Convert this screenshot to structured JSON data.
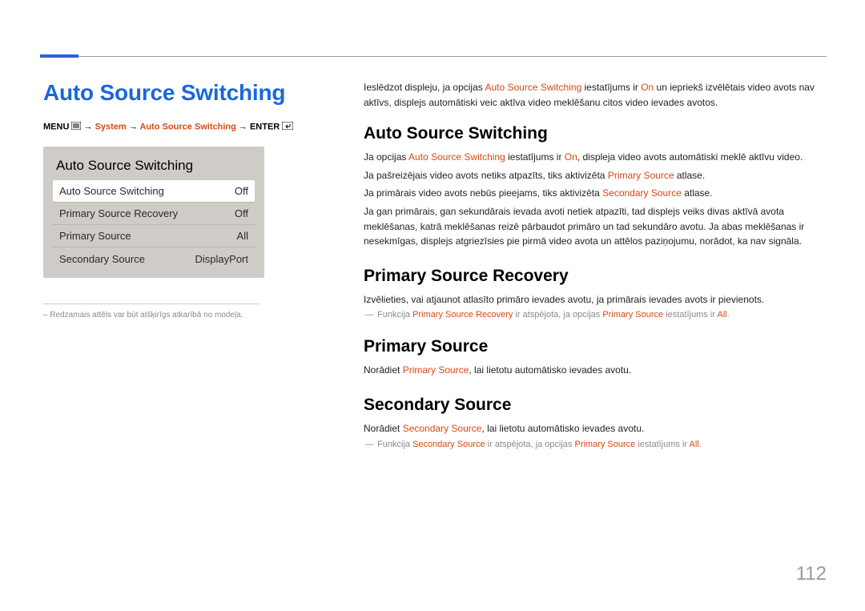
{
  "page_title": "Auto Source Switching",
  "breadcrumb": {
    "menu": "MENU",
    "arrow": "→",
    "system": "System",
    "auto": "Auto Source Switching",
    "enter": "ENTER"
  },
  "lcd": {
    "title": "Auto Source Switching",
    "rows": [
      {
        "label": "Auto Source Switching",
        "value": "Off",
        "selected": true
      },
      {
        "label": "Primary Source Recovery",
        "value": "Off",
        "selected": false
      },
      {
        "label": "Primary Source",
        "value": "All",
        "selected": false
      },
      {
        "label": "Secondary Source",
        "value": "DisplayPort",
        "selected": false
      }
    ]
  },
  "left_footnote": "– Redzamais attēls var būt atšķirīgs atkarībā no modeļa.",
  "intro": {
    "p1a": "Ieslēdzot displeju, ja opcijas ",
    "p1b": "Auto Source Switching",
    "p1c": " iestatījums ir ",
    "p1d": "On",
    "p1e": " un iepriekš izvēlētais video avots nav aktīvs, displejs automātiski veic aktīva video meklēšanu citos video ievades avotos."
  },
  "sections": {
    "auto": {
      "heading": "Auto Source Switching",
      "p1a": "Ja opcijas ",
      "p1b": "Auto Source Switching",
      "p1c": " iestatījums ir ",
      "p1d": "On",
      "p1e": ", displeja video avots automātiski meklē aktīvu video.",
      "p2a": "Ja pašreizējais video avots netiks atpazīts, tiks aktivizēta ",
      "p2b": "Primary Source",
      "p2c": " atlase.",
      "p3a": "Ja primārais video avots nebūs pieejams, tiks aktivizēta ",
      "p3b": "Secondary Source",
      "p3c": " atlase.",
      "p4": "Ja gan primārais, gan sekundārais ievada avoti netiek atpazīti, tad displejs veiks divas aktīvā avota meklēšanas, katrā meklēšanas reizē pārbaudot primāro un tad sekundāro avotu. Ja abas meklēšanas ir nesekmīgas, displejs atgriezīsies pie pirmā video avota un attēlos paziņojumu, norādot, ka nav signāla."
    },
    "primary_recovery": {
      "heading": "Primary Source Recovery",
      "p1": "Izvēlieties, vai atjaunot atlasīto primāro ievades avotu, ja primārais ievades avots ir pievienots.",
      "note_dash": "―",
      "note_a": "Funkcija ",
      "note_b": "Primary Source Recovery",
      "note_c": " ir atspējota, ja opcijas ",
      "note_d": "Primary Source",
      "note_e": " iestatījums ir ",
      "note_f": "All",
      "note_g": "."
    },
    "primary": {
      "heading": "Primary Source",
      "p1a": "Norādiet ",
      "p1b": "Primary Source",
      "p1c": ", lai lietotu automātisko ievades avotu."
    },
    "secondary": {
      "heading": "Secondary Source",
      "p1a": "Norādiet ",
      "p1b": "Secondary Source",
      "p1c": ", lai lietotu automātisko ievades avotu.",
      "note_dash": "―",
      "note_a": "Funkcija ",
      "note_b": "Secondary Source",
      "note_c": " ir atspējota, ja opcijas ",
      "note_d": "Primary Source",
      "note_e": " iestatījums ir ",
      "note_f": "All",
      "note_g": "."
    }
  },
  "page_number": "112"
}
